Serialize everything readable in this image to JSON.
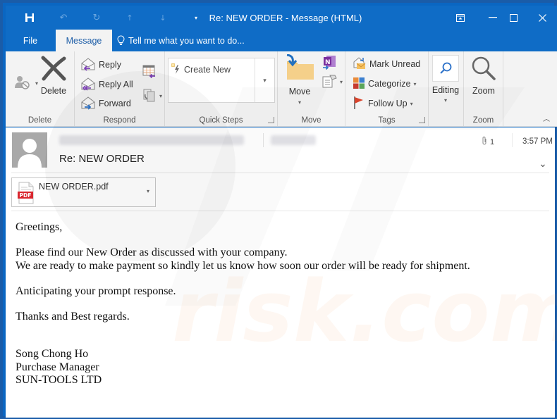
{
  "window": {
    "title": "Re: NEW ORDER  -  Message (HTML)",
    "quick_access": [
      "save-icon",
      "undo-icon",
      "redo-icon",
      "previous-item-icon",
      "next-item-icon",
      "customize-qat-icon"
    ],
    "controls": [
      "ribbon-display-options-icon",
      "minimize-icon",
      "maximize-icon",
      "close-icon"
    ]
  },
  "tabs": {
    "file": "File",
    "message": "Message",
    "tell_me": "Tell me what you want to do..."
  },
  "ribbon": {
    "delete_group": {
      "label": "Delete",
      "ignore_icon": "ignore-icon",
      "delete": "Delete"
    },
    "respond_group": {
      "label": "Respond",
      "reply": "Reply",
      "reply_all": "Reply All",
      "forward": "Forward",
      "meeting_icon": "meeting-icon",
      "more_icon": "more-respond-icon"
    },
    "quick_steps_group": {
      "label": "Quick Steps",
      "create_new": "Create New"
    },
    "move_group": {
      "label": "Move",
      "move": "Move",
      "onenote_icon": "onenote-icon",
      "actions_icon": "actions-icon"
    },
    "tags_group": {
      "label": "Tags",
      "mark_unread": "Mark Unread",
      "categorize": "Categorize",
      "follow_up": "Follow Up"
    },
    "editing_group": {
      "editing": "Editing"
    },
    "zoom_group": {
      "label": "Zoom",
      "zoom": "Zoom"
    }
  },
  "message": {
    "subject": "Re: NEW ORDER",
    "attachment_count": "1",
    "time": "3:57 PM",
    "attachment": {
      "name": "NEW ORDER.pdf",
      "type_badge": "PDF"
    },
    "body": {
      "greeting": "Greetings,",
      "line1": "Please find our New Order as discussed with your company.",
      "line2": "We are ready to make payment so kindly let us know how soon our order will be ready for shipment.",
      "line3": "Anticipating your prompt response.",
      "line4": "Thanks and Best regards.",
      "sig_name": "Song Chong Ho",
      "sig_title": "Purchase Manager",
      "sig_company": "SUN-TOOLS LTD"
    }
  },
  "colors": {
    "titlebar": "#0f6cc6",
    "ribbon": "#f3f3f3",
    "accent_purple": "#7b3fb5",
    "pdf_red": "#d9262e",
    "flag_red": "#d9442c"
  }
}
